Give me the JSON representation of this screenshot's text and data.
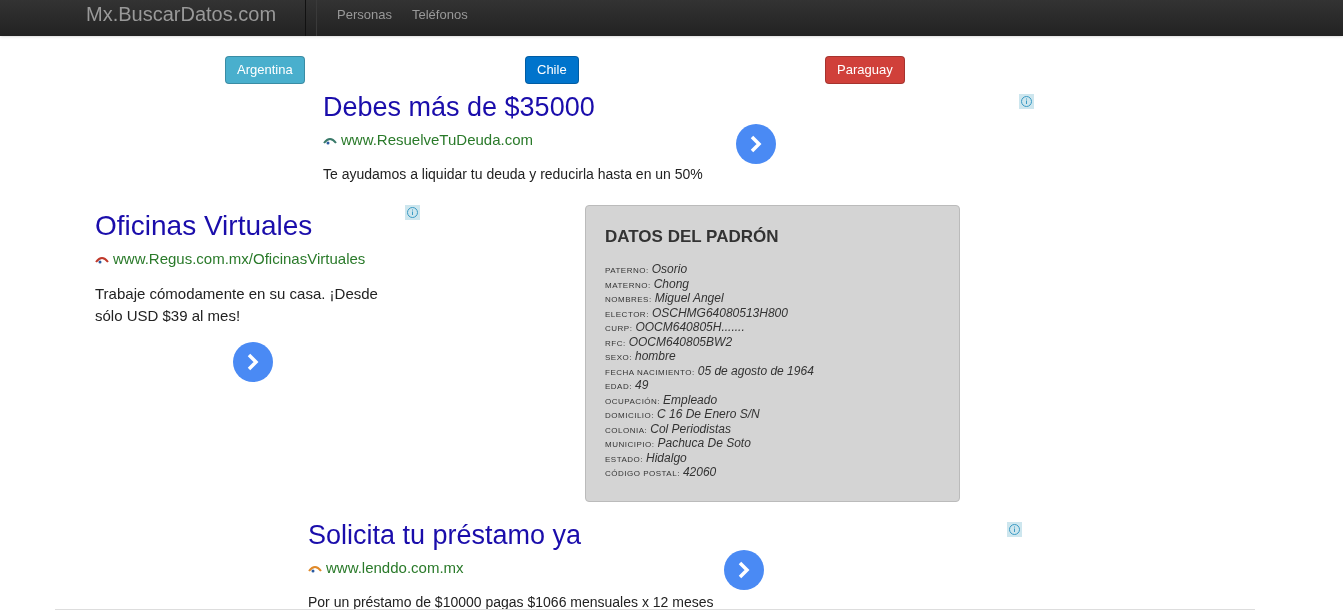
{
  "navbar": {
    "brand": "Mx.BuscarDatos.com",
    "links": [
      {
        "label": "Personas"
      },
      {
        "label": "Teléfonos"
      }
    ]
  },
  "countries": [
    {
      "label": "Argentina",
      "color": "#49afcd"
    },
    {
      "label": "Chile",
      "color": "#0074cc"
    },
    {
      "label": "Paraguay",
      "color": "#d0403a"
    }
  ],
  "ads": [
    {
      "title": "Debes más de $35000",
      "url": "www.ResuelveTuDeuda.com",
      "description": "Te ayudamos a liquidar tu deuda y reducirla hasta en un 50%"
    },
    {
      "title": "Oficinas Virtuales",
      "url": "www.Regus.com.mx/OficinasVirtuales",
      "description": "Trabaje cómodamente en su casa. ¡Desde sólo USD $39 al mes!"
    },
    {
      "title": "Solicita tu préstamo ya",
      "url": "www.lenddo.com.mx",
      "description": "Por un préstamo de $10000 pagas $1066 mensuales x 12 meses"
    }
  ],
  "padron": {
    "title": "DATOS DEL PADRÓN",
    "fields": [
      {
        "label": "PATERNO:",
        "value": "Osorio"
      },
      {
        "label": "MATERNO:",
        "value": "Chong"
      },
      {
        "label": "NOMBRES:",
        "value": "Miguel Angel"
      },
      {
        "label": "ELECTOR:",
        "value": "OSCHMG64080513H800"
      },
      {
        "label": "CURP:",
        "value": "OOCM640805H......."
      },
      {
        "label": "RFC:",
        "value": "OOCM640805BW2"
      },
      {
        "label": "SEXO:",
        "value": "hombre"
      },
      {
        "label": "FECHA NACIMIENTO:",
        "value": "05 de agosto de 1964"
      },
      {
        "label": "EDAD:",
        "value": "49"
      },
      {
        "label": "OCUPACIÓN:",
        "value": "Empleado"
      },
      {
        "label": "DOMICILIO:",
        "value": "C 16 De Enero S/N"
      },
      {
        "label": "COLONIA:",
        "value": "Col Periodistas"
      },
      {
        "label": "MUNICIPIO:",
        "value": "Pachuca De Soto"
      },
      {
        "label": "ESTADO:",
        "value": "Hidalgo"
      },
      {
        "label": "CÓDIGO POSTAL:",
        "value": "42060"
      }
    ]
  }
}
